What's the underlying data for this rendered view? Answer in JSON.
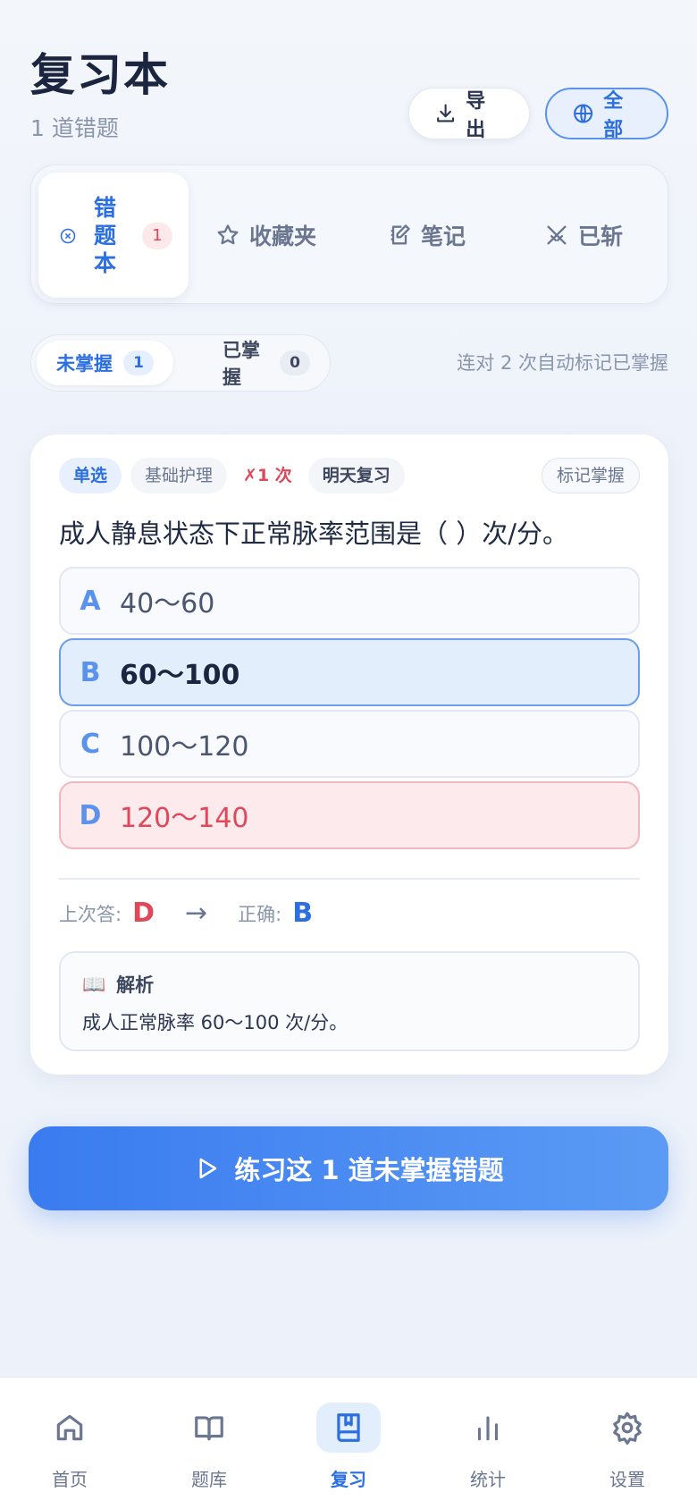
{
  "header": {
    "title": "复习本",
    "subtitle": "1 道错题"
  },
  "actions": {
    "export_label": "导出",
    "scope_label": "全部"
  },
  "tabs": [
    {
      "label": "错题本",
      "count": "1"
    },
    {
      "label": "收藏夹"
    },
    {
      "label": "笔记"
    },
    {
      "label": "已斩"
    }
  ],
  "filter": {
    "unmastered_label": "未掌握",
    "unmastered_count": "1",
    "mastered_label": "已掌握",
    "mastered_count": "0",
    "auto_note": "连对 2 次自动标记已掌握"
  },
  "card": {
    "type_tag": "单选",
    "category_tag": "基础护理",
    "error_tag": "✗1 次",
    "due_tag": "明天复习",
    "mark_label": "标记掌握",
    "question": "成人静息状态下正常脉率范围是（ ）次/分。",
    "options": [
      {
        "key": "A",
        "text": "40～60",
        "state": "normal"
      },
      {
        "key": "B",
        "text": "60～100",
        "state": "selected"
      },
      {
        "key": "C",
        "text": "100～120",
        "state": "normal"
      },
      {
        "key": "D",
        "text": "120～140",
        "state": "wrong"
      }
    ],
    "last_answer_label": "上次答:",
    "last_answer": "D",
    "arrow": "→",
    "correct_label": "正确:",
    "correct_answer": "B",
    "explain_icon": "📖",
    "explain_title": "解析",
    "explain_text": "成人正常脉率 60～100 次/分。"
  },
  "practice_button": "练习这 1 道未掌握错题",
  "nav": [
    {
      "label": "首页",
      "icon": "home-icon"
    },
    {
      "label": "题库",
      "icon": "book-open-icon"
    },
    {
      "label": "复习",
      "icon": "bookmark-book-icon",
      "active": true
    },
    {
      "label": "统计",
      "icon": "bar-chart-icon"
    },
    {
      "label": "设置",
      "icon": "gear-icon"
    }
  ],
  "colors": {
    "accent": "#2c6fe0",
    "error": "#e0485a",
    "background": "#eef3fb"
  }
}
